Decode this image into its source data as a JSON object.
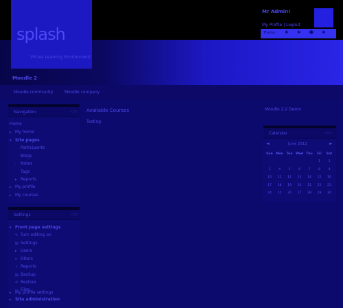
{
  "header": {
    "logo_text": "splash",
    "tagline": "Virtual Learning Environment",
    "user_name": "Mr Admin!",
    "profile_links": "My Profile | Logout",
    "theme_label": "Theme :",
    "site_short_name": "Moodle 2"
  },
  "navbar": {
    "links": [
      "Moodle community",
      "Moodle company"
    ]
  },
  "navigation_block": {
    "title": "Navigation",
    "items": [
      "Home",
      "My home",
      "Site pages",
      "Participants",
      "Blogs",
      "Notes",
      "Tags",
      "Reports",
      "My profile",
      "My courses"
    ]
  },
  "settings_block": {
    "title": "Settings",
    "items": [
      "Front page settings",
      "Turn editing on",
      "Settings",
      "Users",
      "Filters",
      "Reports",
      "Backup",
      "Restore",
      "Files",
      "My profile settings",
      "Site administration"
    ]
  },
  "main": {
    "title": "Available Courses",
    "course": "Testing"
  },
  "right": {
    "site_title": "Moodle 2.2 Demo"
  },
  "calendar": {
    "title": "Calendar",
    "month_label": "June 2012",
    "prev": "◄",
    "next": "►",
    "weekdays": [
      "Sun",
      "Mon",
      "Tue",
      "Wed",
      "Thu",
      "Fri",
      "Sat"
    ],
    "weeks": [
      [
        "",
        "",
        "",
        "",
        "",
        "1",
        "2"
      ],
      [
        "3",
        "4",
        "5",
        "6",
        "7",
        "8",
        "9"
      ],
      [
        "10",
        "11",
        "12",
        "13",
        "14",
        "15",
        "16"
      ],
      [
        "17",
        "18",
        "19",
        "20",
        "21",
        "22",
        "23"
      ],
      [
        "24",
        "25",
        "26",
        "27",
        "28",
        "29",
        "30"
      ]
    ]
  }
}
